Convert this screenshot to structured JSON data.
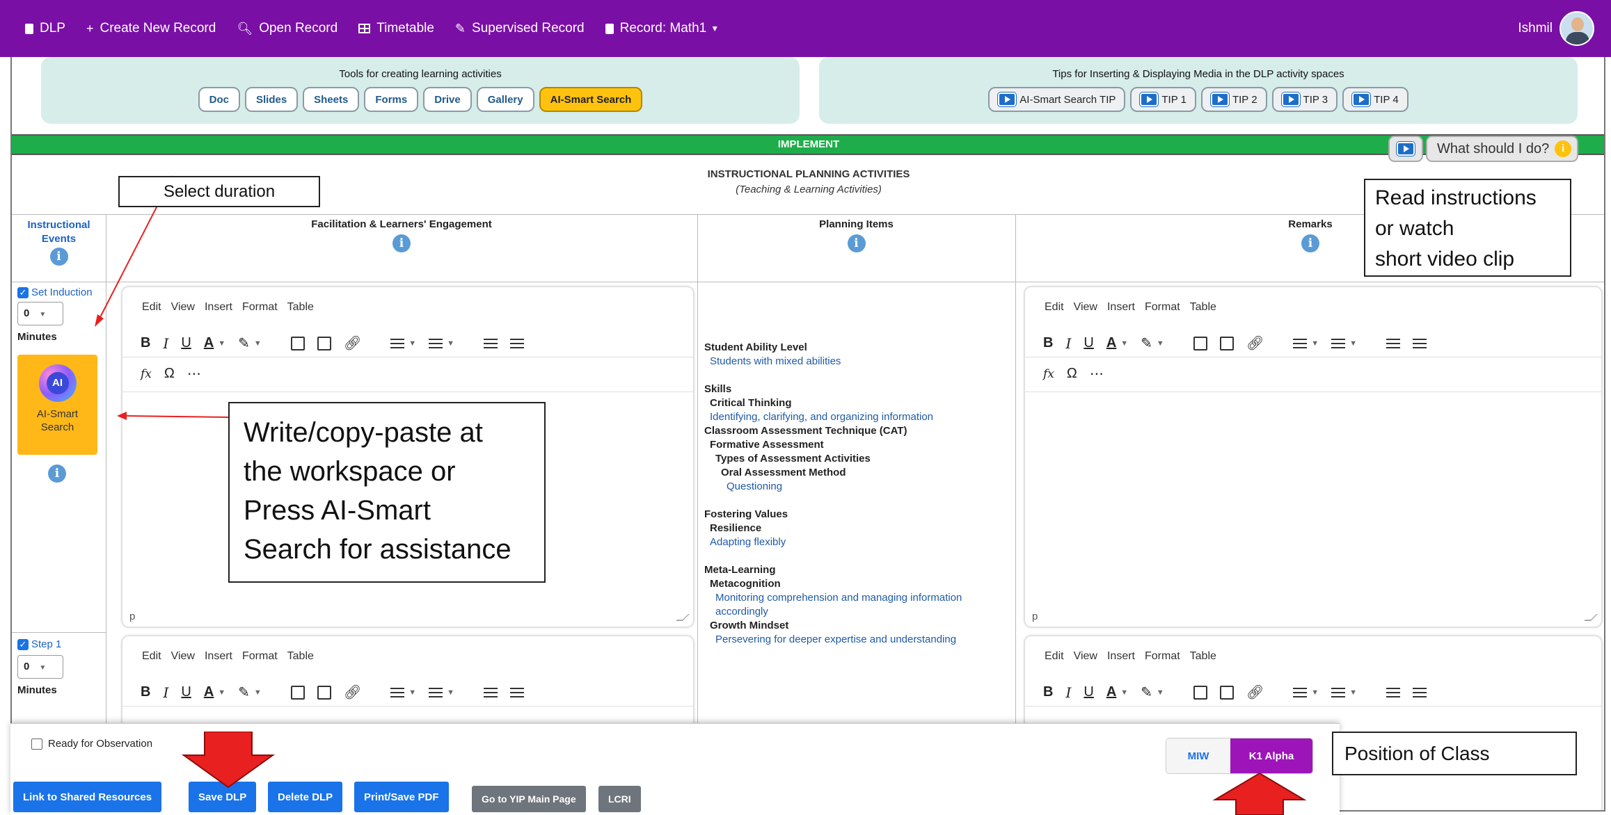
{
  "nav": {
    "items": [
      {
        "label": "DLP",
        "icon": "document-icon"
      },
      {
        "label": "Create New Record",
        "icon": "plus-icon"
      },
      {
        "label": "Open Record",
        "icon": "search-icon"
      },
      {
        "label": "Timetable",
        "icon": "table-icon"
      },
      {
        "label": "Supervised Record",
        "icon": "edit-icon"
      },
      {
        "label": "Record: Math1",
        "icon": "document-icon"
      }
    ],
    "user": "Ishmil"
  },
  "tools": {
    "title": "Tools for creating learning activities",
    "buttons": [
      "Doc",
      "Slides",
      "Sheets",
      "Forms",
      "Drive",
      "Gallery",
      "AI-Smart Search"
    ]
  },
  "tips": {
    "title": "Tips for Inserting & Displaying Media in the DLP activity spaces",
    "buttons": [
      "AI-Smart Search TIP",
      "TIP 1",
      "TIP 2",
      "TIP 3",
      "TIP 4"
    ]
  },
  "section": {
    "title": "IMPLEMENT",
    "what_label": "What should I do?",
    "heading": "INSTRUCTIONAL PLANNING ACTIVITIES",
    "subheading": "(Teaching & Learning Activities)"
  },
  "columns": {
    "events": "Instructional Events",
    "facilitation": "Facilitation & Learners' Engagement",
    "planning": "Planning Items",
    "remarks": "Remarks"
  },
  "events": [
    {
      "label": "Set Induction",
      "duration": "0",
      "unit": "Minutes"
    },
    {
      "label": "Step 1",
      "duration": "0",
      "unit": "Minutes"
    }
  ],
  "ai_side": {
    "icon_text": "AI",
    "label": "AI-Smart Search"
  },
  "editor": {
    "menus": [
      "Edit",
      "View",
      "Insert",
      "Format",
      "Table"
    ],
    "status": "p"
  },
  "planning": [
    {
      "kind": "h",
      "indent": 0,
      "text": "Student Ability Level"
    },
    {
      "kind": "v",
      "indent": 1,
      "text": "Students with mixed abilities"
    },
    {
      "kind": "gap"
    },
    {
      "kind": "h",
      "indent": 0,
      "text": "Skills"
    },
    {
      "kind": "h",
      "indent": 1,
      "text": "Critical Thinking"
    },
    {
      "kind": "v",
      "indent": 1,
      "text": "Identifying, clarifying, and organizing information"
    },
    {
      "kind": "h",
      "indent": 0,
      "text": "Classroom Assessment Technique (CAT)"
    },
    {
      "kind": "h",
      "indent": 1,
      "text": "Formative Assessment"
    },
    {
      "kind": "h",
      "indent": 2,
      "text": "Types of Assessment Activities"
    },
    {
      "kind": "h",
      "indent": 3,
      "text": "Oral Assessment Method"
    },
    {
      "kind": "v",
      "indent": 4,
      "text": "Questioning"
    },
    {
      "kind": "gap"
    },
    {
      "kind": "h",
      "indent": 0,
      "text": "Fostering Values"
    },
    {
      "kind": "h",
      "indent": 1,
      "text": "Resilience"
    },
    {
      "kind": "v",
      "indent": 1,
      "text": "Adapting flexibly"
    },
    {
      "kind": "gap"
    },
    {
      "kind": "h",
      "indent": 0,
      "text": "Meta-Learning"
    },
    {
      "kind": "h",
      "indent": 1,
      "text": "Metacognition"
    },
    {
      "kind": "v",
      "indent": 2,
      "text": "Monitoring comprehension and managing information"
    },
    {
      "kind": "v",
      "indent": 2,
      "text": "accordingly"
    },
    {
      "kind": "h",
      "indent": 1,
      "text": "Growth Mindset"
    },
    {
      "kind": "v",
      "indent": 2,
      "text": "Persevering for deeper expertise and understanding"
    }
  ],
  "annotations": {
    "duration": "Select duration",
    "instructions": [
      "Read instructions",
      "or watch",
      "short video clip"
    ],
    "write": [
      "Write/copy-paste at",
      "the workspace or",
      "Press AI-Smart",
      "Search for assistance"
    ],
    "position": "Position of Class"
  },
  "footer": {
    "ready_label": "Ready for Observation",
    "buttons": [
      "Link to Shared Resources",
      "Save DLP",
      "Delete DLP",
      "Print/Save PDF"
    ],
    "gray_buttons": [
      "Go to YIP Main Page",
      "LCRI"
    ],
    "class_tabs": [
      "MIW",
      "K1 Alpha"
    ]
  },
  "colors": {
    "nav": "#7a0fa6",
    "implement": "#1ead4a",
    "accent": "#ffc20e",
    "primary": "#1a73e8",
    "class_active": "#9d15b8",
    "arrow": "#e8201f"
  }
}
